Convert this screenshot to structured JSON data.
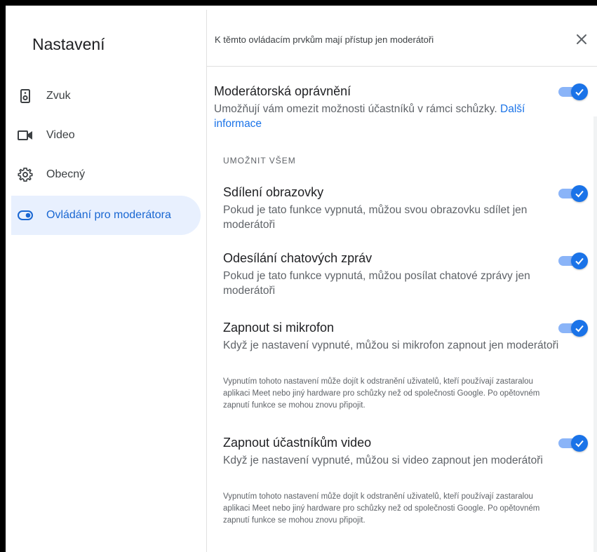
{
  "sidebar": {
    "title": "Nastavení",
    "items": [
      {
        "label": "Zvuk",
        "icon": "speaker-icon"
      },
      {
        "label": "Video",
        "icon": "video-camera-icon"
      },
      {
        "label": "Obecný",
        "icon": "gear-icon"
      },
      {
        "label": "Ovládání pro moderátora",
        "icon": "toggle-icon",
        "active": true
      }
    ]
  },
  "panel": {
    "header_text": "K těmto ovládacím prvkům mají přístup jen moderátoři",
    "main": {
      "title": "Moderátorská oprávnění",
      "desc": "Umožňují vám omezit možnosti účastníků v rámci schůzky.",
      "link": "Další informace",
      "enabled": true
    },
    "section_label": "UMOŽNIT VŠEM",
    "settings": [
      {
        "title": "Sdílení obrazovky",
        "desc": "Pokud je tato funkce vypnutá, můžou svou obrazovku sdílet jen moderátoři",
        "enabled": true
      },
      {
        "title": "Odesílání chatových zpráv",
        "desc": "Pokud je tato funkce vypnutá, můžou posílat chatové zprávy jen moderátoři",
        "enabled": true
      },
      {
        "title": "Zapnout si mikrofon",
        "desc": "Když je nastavení vypnuté, můžou si mikrofon zapnout jen moderátoři",
        "note": "Vypnutím tohoto nastavení může dojít k odstranění uživatelů, kteří používají zastaralou aplikaci Meet nebo jiný hardware pro schůzky než od společnosti Google. Po opětovném zapnutí funkce se mohou znovu připojit.",
        "enabled": true
      },
      {
        "title": "Zapnout účastníkům video",
        "desc": "Když je nastavení vypnuté, můžou si video zapnout jen moderátoři",
        "note": "Vypnutím tohoto nastavení může dojít k odstranění uživatelů, kteří používají zastaralou aplikaci Meet nebo jiný hardware pro schůzky než od společnosti Google. Po opětovném zapnutí funkce se mohou znovu připojit.",
        "enabled": true
      }
    ]
  },
  "colors": {
    "accent": "#1a73e8",
    "active_bg": "#e8f0fe",
    "toggle_track": "#8ab4f8"
  }
}
